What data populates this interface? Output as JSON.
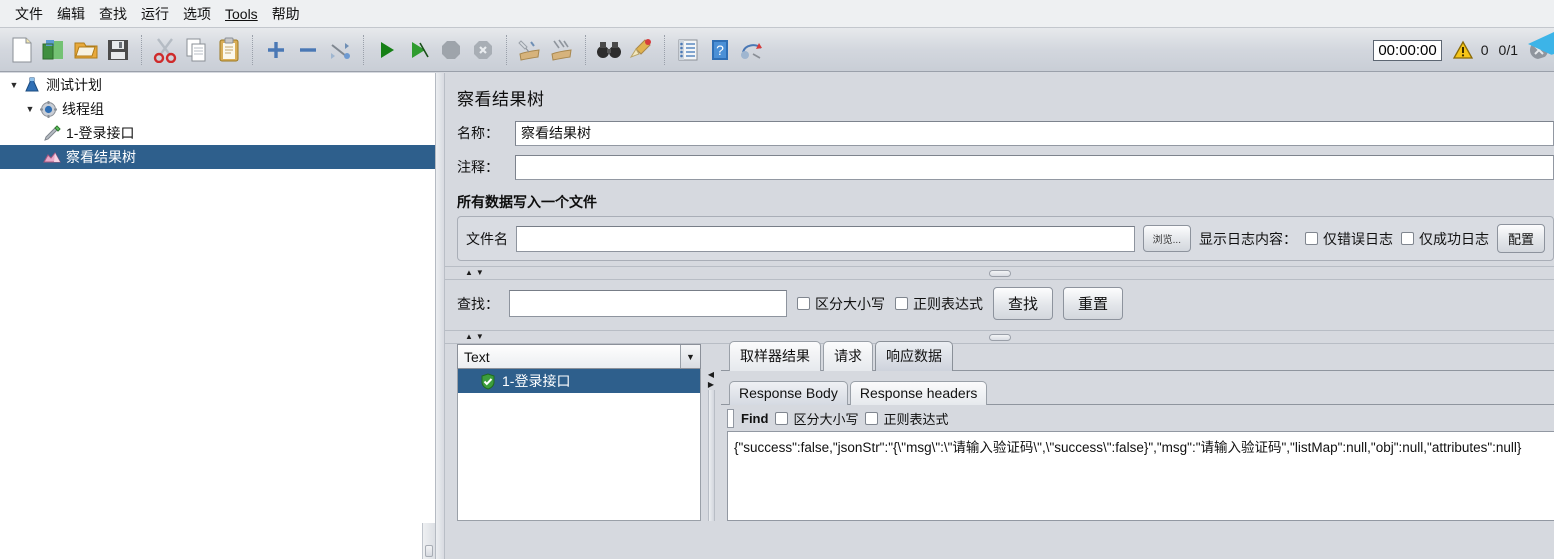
{
  "menubar": {
    "items": [
      {
        "label": "文件",
        "name": "menu-file"
      },
      {
        "label": "编辑",
        "name": "menu-edit"
      },
      {
        "label": "查找",
        "name": "menu-search"
      },
      {
        "label": "运行",
        "name": "menu-run"
      },
      {
        "label": "选项",
        "name": "menu-options"
      },
      {
        "label": "Tools",
        "name": "menu-tools"
      },
      {
        "label": "帮助",
        "name": "menu-help"
      }
    ]
  },
  "toolbar": {
    "icons": [
      "new-icon",
      "templates-icon",
      "open-icon",
      "save-icon",
      "cut-icon",
      "copy-icon",
      "paste-icon",
      "expand-icon",
      "collapse-icon",
      "toggle-icon",
      "start-icon",
      "start-no-timers-icon",
      "stop-icon",
      "shutdown-icon",
      "clear-icon",
      "clear-all-icon",
      "search-icon",
      "search-reset-icon",
      "function-helper-icon",
      "help-icon",
      "undo-redo-icon"
    ],
    "timer": "00:00:00",
    "warning_count": "0",
    "run_count": "0/1",
    "warning_icon": "warning-triangle-icon",
    "error_icon": "error-circle-icon"
  },
  "tree": {
    "nodes": [
      {
        "label": "测试计划",
        "icon": "test-plan-icon",
        "toggle": "▼",
        "depth": 0,
        "selected": false
      },
      {
        "label": "线程组",
        "icon": "thread-group-icon",
        "toggle": "▼",
        "depth": 1,
        "selected": false
      },
      {
        "label": "1-登录接口",
        "icon": "http-sampler-icon",
        "toggle": "",
        "depth": 2,
        "selected": false
      },
      {
        "label": "察看结果树",
        "icon": "view-results-tree-icon",
        "toggle": "",
        "depth": 2,
        "selected": true
      }
    ]
  },
  "panel": {
    "title": "察看结果树",
    "name_label": "名称：",
    "name_value": "察看结果树",
    "comment_label": "注释：",
    "comment_value": "",
    "file_group": {
      "title": "所有数据写入一个文件",
      "filename_label": "文件名",
      "filename_value": "",
      "browse_label": "浏览...",
      "log_display_label": "显示日志内容：",
      "errors_only_label": "仅错误日志",
      "errors_only_checked": false,
      "successes_only_label": "仅成功日志",
      "successes_only_checked": false,
      "configure_label": "配置"
    },
    "search": {
      "label": "查找：",
      "value": "",
      "case_sensitive_label": "区分大小写",
      "case_sensitive_checked": false,
      "regex_label": "正则表达式",
      "regex_checked": false,
      "search_button": "查找",
      "reset_button": "重置"
    }
  },
  "results": {
    "render_combo_value": "Text",
    "combo_arrow_icon": "chevron-down-icon",
    "items": [
      {
        "label": "1-登录接口",
        "icon": "success-shield-icon",
        "selected": true
      }
    ],
    "tabs": [
      {
        "label": "取样器结果",
        "active": false
      },
      {
        "label": "请求",
        "active": false
      },
      {
        "label": "响应数据",
        "active": true
      }
    ],
    "subtabs": [
      {
        "label": "Response Body",
        "active": true
      },
      {
        "label": "Response headers",
        "active": false
      }
    ],
    "find": {
      "label": "Find",
      "value": "",
      "case_sensitive_label": "区分大小写",
      "case_sensitive_checked": false,
      "regex_label": "正则表达式",
      "regex_checked": false
    },
    "response_body": "{\"success\":false,\"jsonStr\":\"{\\\"msg\\\":\\\"请输入验证码\\\",\\\"success\\\":false}\",\"msg\":\"请输入验证码\",\"listMap\":null,\"obj\":null,\"attributes\":null}"
  },
  "colors": {
    "selection_blue": "#2e5f8c",
    "panel_grey": "#d6d9df",
    "toolbar_grey": "#d3d7de",
    "warning_yellow": "#f5c518",
    "success_green": "#3d9e3d",
    "accent_cyan": "#3cb4e8"
  }
}
